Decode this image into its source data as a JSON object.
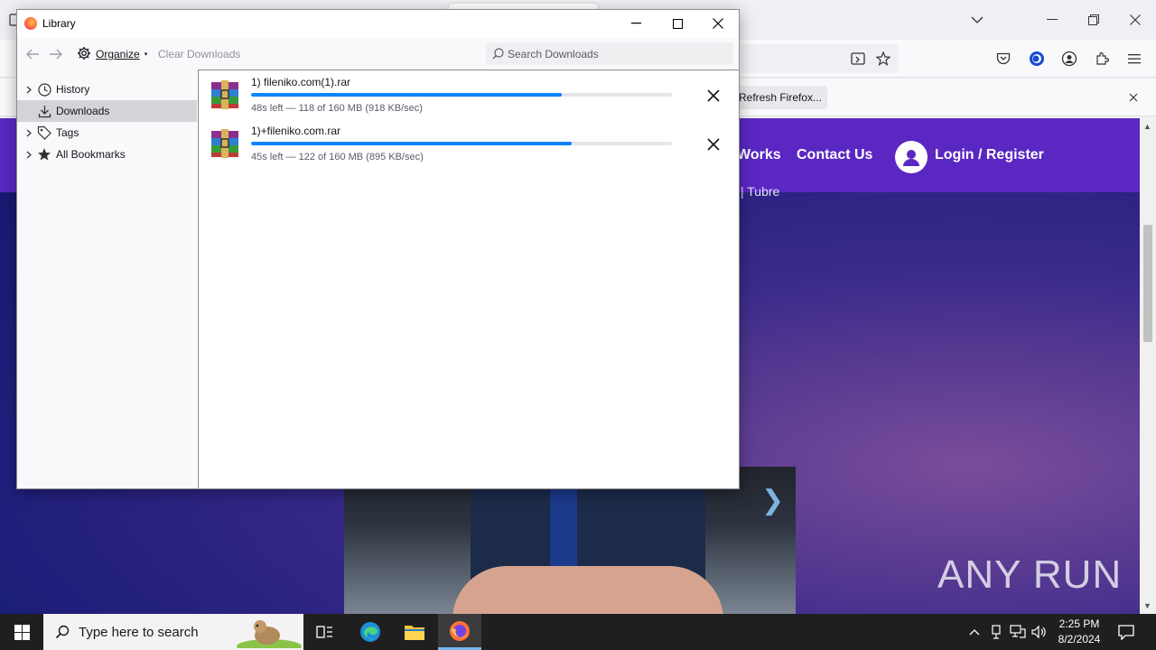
{
  "browser": {
    "refresh_button": "Refresh Firefox...",
    "site_nav": {
      "works_link": "Works",
      "contact_link": "Contact Us",
      "login_link": "Login / Register"
    },
    "page_subtext": "| Tubre",
    "watermark": "ANY RUN"
  },
  "library": {
    "title": "Library",
    "toolbar": {
      "organize_label": "Organize",
      "clear_label": "Clear Downloads",
      "search_placeholder": "Search Downloads"
    },
    "sidebar": {
      "items": [
        {
          "label": "History",
          "icon": "clock-icon",
          "expandable": true,
          "selected": false
        },
        {
          "label": "Downloads",
          "icon": "download-icon",
          "expandable": false,
          "selected": true
        },
        {
          "label": "Tags",
          "icon": "tag-icon",
          "expandable": true,
          "selected": false
        },
        {
          "label": "All Bookmarks",
          "icon": "star-icon",
          "expandable": true,
          "selected": false
        }
      ]
    },
    "downloads": [
      {
        "name": "1) fileniko.com(1).rar",
        "status": "48s left — 118 of 160 MB (918 KB/sec)",
        "progress": 0.7375
      },
      {
        "name": "1)+fileniko.com.rar",
        "status": "45s left — 122 of 160 MB (895 KB/sec)",
        "progress": 0.7625
      }
    ]
  },
  "taskbar": {
    "search_placeholder": "Type here to search",
    "clock_time": "2:25 PM",
    "clock_date": "8/2/2024"
  },
  "colors": {
    "progress_fill": "#0a84ff",
    "site_nav_bg": "#5a27c3",
    "selected_sidebar": "#d3d3d8"
  }
}
